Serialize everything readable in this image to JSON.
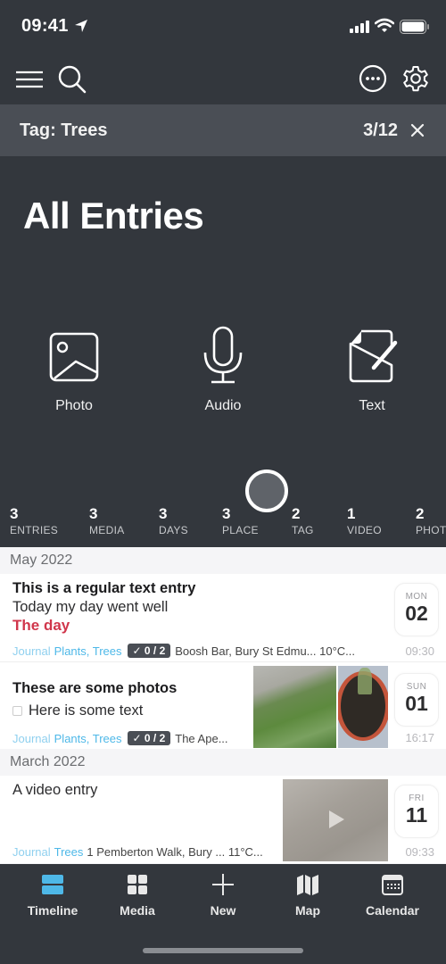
{
  "status_bar": {
    "time": "09:41"
  },
  "tag_filter": {
    "label": "Tag: Trees",
    "count": "3/12"
  },
  "header": {
    "title": "All Entries"
  },
  "quick_actions": [
    {
      "label": "Photo",
      "icon": "photo-icon"
    },
    {
      "label": "Audio",
      "icon": "microphone-icon"
    },
    {
      "label": "Text",
      "icon": "text-edit-icon"
    }
  ],
  "stats": [
    {
      "value": "3",
      "label": "ENTRIES"
    },
    {
      "value": "3",
      "label": "MEDIA"
    },
    {
      "value": "3",
      "label": "DAYS"
    },
    {
      "value": "3",
      "label": "PLACE"
    },
    {
      "value": "2",
      "label": "TAG"
    },
    {
      "value": "1",
      "label": "VIDEO"
    },
    {
      "value": "2",
      "label": "PHOTO"
    }
  ],
  "sections": [
    {
      "header": "May 2022",
      "entries": [
        {
          "title": "This is a regular text entry",
          "body": "Today my day went well",
          "highlight": "The day",
          "journal": "Journal",
          "tags": "Plants, Trees",
          "checklist": "✓ 0 / 2",
          "location": "Boosh Bar, Bury St Edmu... 10°C...",
          "dow": "MON",
          "day": "02",
          "time": "09:30"
        },
        {
          "title": "These are some photos",
          "body": "Here is some text",
          "journal": "Journal",
          "tags": "Plants, Trees",
          "checklist": "✓ 0 / 2",
          "location": "The Ape...",
          "dow": "SUN",
          "day": "01",
          "time": "16:17"
        }
      ]
    },
    {
      "header": "March 2022",
      "entries": [
        {
          "title": "A video entry",
          "journal": "Journal",
          "tags": "Trees",
          "location": "1 Pemberton Walk, Bury ... 11°C...",
          "dow": "FRI",
          "day": "11",
          "time": "09:33"
        }
      ]
    }
  ],
  "tab_bar": [
    {
      "label": "Timeline",
      "active": true
    },
    {
      "label": "Media",
      "active": false
    },
    {
      "label": "New",
      "active": false
    },
    {
      "label": "Map",
      "active": false
    },
    {
      "label": "Calendar",
      "active": false
    }
  ],
  "colors": {
    "background": "#33373d",
    "tag_bar": "#4a4e55",
    "accent": "#4eb8e8",
    "highlight_red": "#d0364b"
  }
}
